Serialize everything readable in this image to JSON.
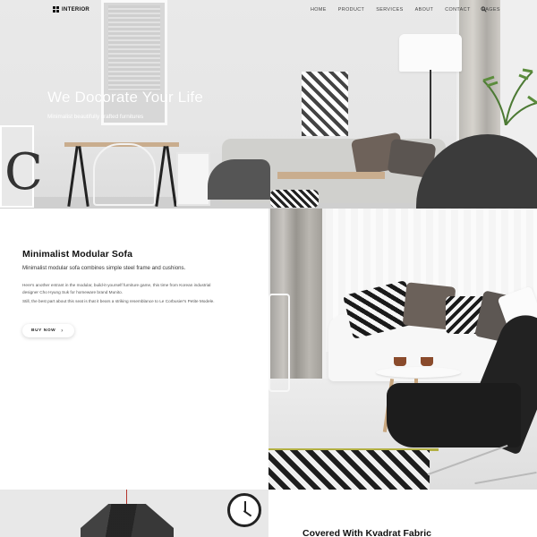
{
  "nav": {
    "logo": "INTERIOR",
    "items": [
      "HOME",
      "PRODUCT",
      "SERVICES",
      "ABOUT",
      "CONTACT",
      "PAGES"
    ],
    "search_icon": "search-icon"
  },
  "hero": {
    "title": "We Docorate Your Life",
    "subtitle": "Minimalist beautifully crafted furnitures"
  },
  "product": {
    "title": "Minimalist Modular Sofa",
    "subtitle": "Minimalist modular sofa combines simple steel frame and cushions.",
    "paragraphs": [
      "Here's another entrant in the modular, build-it-yourself furniture game, this time from Korean industrial designer Cho Hyung Suk for homeware brand Munito.",
      "Still, the best part about this seat is that it bears a striking resemblance to Le Corbusier's Petite Modele."
    ],
    "buy_label": "BUY NOW",
    "buy_arrow": "›"
  },
  "bottom": {
    "title": "Covered With Kvadrat Fabric"
  },
  "colors": {
    "accent_cord": "#b5352d",
    "text_dark": "#111111",
    "hero_text": "#ffffff"
  }
}
